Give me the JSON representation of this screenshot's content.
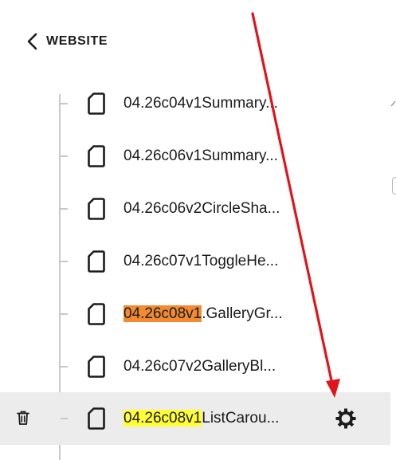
{
  "nav": {
    "back_label": "WEBSITE",
    "back_icon": "chevron-left-icon"
  },
  "pages": [
    {
      "prefix": "",
      "rest": "04.26c04v1Summary...",
      "highlight": "none",
      "selected": false
    },
    {
      "prefix": "",
      "rest": "04.26c06v1Summary...",
      "highlight": "none",
      "selected": false
    },
    {
      "prefix": "",
      "rest": "04.26c06v2CircleSha...",
      "highlight": "none",
      "selected": false
    },
    {
      "prefix": "",
      "rest": "04.26c07v1ToggleHe...",
      "highlight": "none",
      "selected": false
    },
    {
      "prefix": "04.26c08v1",
      "rest": ".GalleryGr...",
      "highlight": "orange",
      "selected": false
    },
    {
      "prefix": "",
      "rest": "04.26c07v2GalleryBl...",
      "highlight": "none",
      "selected": false
    },
    {
      "prefix": "04.26c08v1",
      "rest": "ListCarou...",
      "highlight": "yellow",
      "selected": true
    }
  ],
  "icons": {
    "page": "page-icon",
    "trash": "trash-icon",
    "settings": "gear-icon"
  },
  "colors": {
    "highlight_orange": "#f28b30",
    "highlight_yellow": "#ffff33",
    "selected_row": "#ececec",
    "annotation_arrow": "#e0141b",
    "tree_line": "#c8c8c8"
  }
}
